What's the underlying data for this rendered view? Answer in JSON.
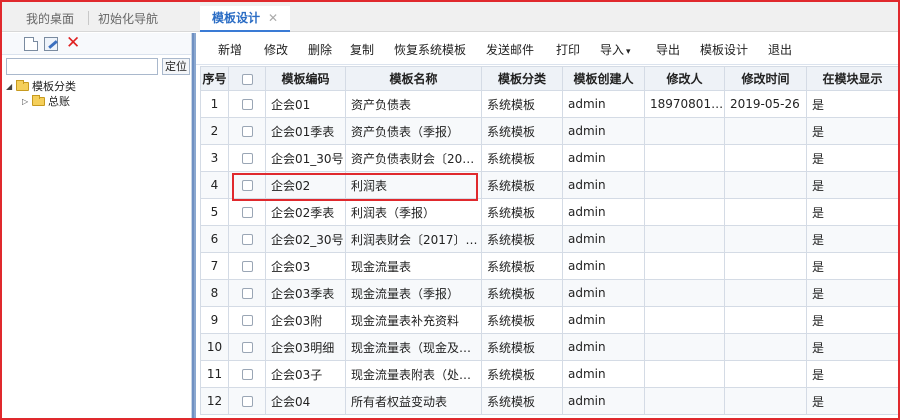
{
  "tabs": [
    {
      "label": "我的桌面"
    },
    {
      "label": "初始化导航"
    },
    {
      "label": "模板设计",
      "close": "✕"
    }
  ],
  "left_panel": {
    "search_placeholder": "",
    "locate_label": "定位",
    "tree": [
      {
        "toggle": "◢",
        "label": "模板分类"
      },
      {
        "toggle": "▷",
        "label": "总账"
      }
    ]
  },
  "toolbar": {
    "items": [
      "新增",
      "修改",
      "删除",
      "复制",
      "恢复系统模板",
      "发送邮件",
      "打印",
      "导入",
      "导出",
      "模板设计",
      "退出"
    ],
    "import_chevron": "▾"
  },
  "table": {
    "headers": [
      "序号",
      "",
      "模板编码",
      "模板名称",
      "模板分类",
      "模板创建人",
      "修改人",
      "修改时间",
      "在模块显示"
    ],
    "rows": [
      {
        "no": "1",
        "code": "企会01",
        "name": "资产负债表",
        "category": "系统模板",
        "creator": "admin",
        "modifier": "18970801…",
        "time": "2019-05-26",
        "show": "是"
      },
      {
        "no": "2",
        "code": "企会01季表",
        "name": "资产负债表（季报）",
        "category": "系统模板",
        "creator": "admin",
        "modifier": "",
        "time": "",
        "show": "是"
      },
      {
        "no": "3",
        "code": "企会01_30号",
        "name": "资产负债表财会〔20…",
        "category": "系统模板",
        "creator": "admin",
        "modifier": "",
        "time": "",
        "show": "是"
      },
      {
        "no": "4",
        "code": "企会02",
        "name": "利润表",
        "category": "系统模板",
        "creator": "admin",
        "modifier": "",
        "time": "",
        "show": "是"
      },
      {
        "no": "5",
        "code": "企会02季表",
        "name": "利润表（季报）",
        "category": "系统模板",
        "creator": "admin",
        "modifier": "",
        "time": "",
        "show": "是"
      },
      {
        "no": "6",
        "code": "企会02_30号",
        "name": "利润表财会〔2017〕…",
        "category": "系统模板",
        "creator": "admin",
        "modifier": "",
        "time": "",
        "show": "是"
      },
      {
        "no": "7",
        "code": "企会03",
        "name": "现金流量表",
        "category": "系统模板",
        "creator": "admin",
        "modifier": "",
        "time": "",
        "show": "是"
      },
      {
        "no": "8",
        "code": "企会03季表",
        "name": "现金流量表（季报）",
        "category": "系统模板",
        "creator": "admin",
        "modifier": "",
        "time": "",
        "show": "是"
      },
      {
        "no": "9",
        "code": "企会03附",
        "name": "现金流量表补充资料",
        "category": "系统模板",
        "creator": "admin",
        "modifier": "",
        "time": "",
        "show": "是"
      },
      {
        "no": "10",
        "code": "企会03明细",
        "name": "现金流量表（现金及…",
        "category": "系统模板",
        "creator": "admin",
        "modifier": "",
        "time": "",
        "show": "是"
      },
      {
        "no": "11",
        "code": "企会03子",
        "name": "现金流量表附表（处…",
        "category": "系统模板",
        "creator": "admin",
        "modifier": "",
        "time": "",
        "show": "是"
      },
      {
        "no": "12",
        "code": "企会04",
        "name": "所有者权益变动表",
        "category": "系统模板",
        "creator": "admin",
        "modifier": "",
        "time": "",
        "show": "是"
      }
    ]
  },
  "colors": {
    "accent": "#2a6cc4",
    "highlight": "#e0292d",
    "delete": "#e02020",
    "folder": "#f5cf5a"
  },
  "icons": [
    "new-document-icon",
    "edit-icon",
    "delete-icon",
    "folder-icon",
    "tree-expanded-icon",
    "tree-collapsed-icon",
    "checkbox-icon",
    "chevron-down-icon",
    "close-icon"
  ]
}
